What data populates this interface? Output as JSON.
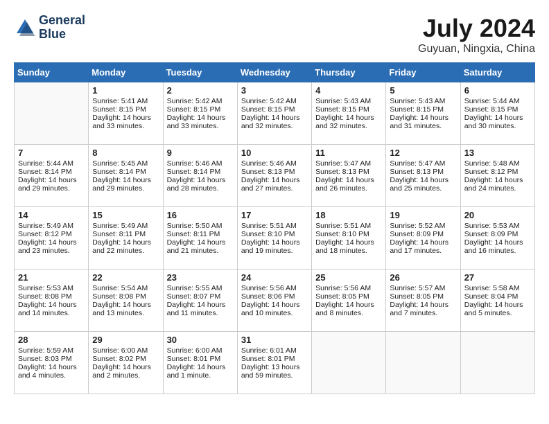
{
  "header": {
    "logo_line1": "General",
    "logo_line2": "Blue",
    "month": "July 2024",
    "location": "Guyuan, Ningxia, China"
  },
  "weekdays": [
    "Sunday",
    "Monday",
    "Tuesday",
    "Wednesday",
    "Thursday",
    "Friday",
    "Saturday"
  ],
  "weeks": [
    [
      {
        "day": "",
        "sunrise": "",
        "sunset": "",
        "daylight": ""
      },
      {
        "day": "1",
        "sunrise": "Sunrise: 5:41 AM",
        "sunset": "Sunset: 8:15 PM",
        "daylight": "Daylight: 14 hours and 33 minutes."
      },
      {
        "day": "2",
        "sunrise": "Sunrise: 5:42 AM",
        "sunset": "Sunset: 8:15 PM",
        "daylight": "Daylight: 14 hours and 33 minutes."
      },
      {
        "day": "3",
        "sunrise": "Sunrise: 5:42 AM",
        "sunset": "Sunset: 8:15 PM",
        "daylight": "Daylight: 14 hours and 32 minutes."
      },
      {
        "day": "4",
        "sunrise": "Sunrise: 5:43 AM",
        "sunset": "Sunset: 8:15 PM",
        "daylight": "Daylight: 14 hours and 32 minutes."
      },
      {
        "day": "5",
        "sunrise": "Sunrise: 5:43 AM",
        "sunset": "Sunset: 8:15 PM",
        "daylight": "Daylight: 14 hours and 31 minutes."
      },
      {
        "day": "6",
        "sunrise": "Sunrise: 5:44 AM",
        "sunset": "Sunset: 8:15 PM",
        "daylight": "Daylight: 14 hours and 30 minutes."
      }
    ],
    [
      {
        "day": "7",
        "sunrise": "Sunrise: 5:44 AM",
        "sunset": "Sunset: 8:14 PM",
        "daylight": "Daylight: 14 hours and 29 minutes."
      },
      {
        "day": "8",
        "sunrise": "Sunrise: 5:45 AM",
        "sunset": "Sunset: 8:14 PM",
        "daylight": "Daylight: 14 hours and 29 minutes."
      },
      {
        "day": "9",
        "sunrise": "Sunrise: 5:46 AM",
        "sunset": "Sunset: 8:14 PM",
        "daylight": "Daylight: 14 hours and 28 minutes."
      },
      {
        "day": "10",
        "sunrise": "Sunrise: 5:46 AM",
        "sunset": "Sunset: 8:13 PM",
        "daylight": "Daylight: 14 hours and 27 minutes."
      },
      {
        "day": "11",
        "sunrise": "Sunrise: 5:47 AM",
        "sunset": "Sunset: 8:13 PM",
        "daylight": "Daylight: 14 hours and 26 minutes."
      },
      {
        "day": "12",
        "sunrise": "Sunrise: 5:47 AM",
        "sunset": "Sunset: 8:13 PM",
        "daylight": "Daylight: 14 hours and 25 minutes."
      },
      {
        "day": "13",
        "sunrise": "Sunrise: 5:48 AM",
        "sunset": "Sunset: 8:12 PM",
        "daylight": "Daylight: 14 hours and 24 minutes."
      }
    ],
    [
      {
        "day": "14",
        "sunrise": "Sunrise: 5:49 AM",
        "sunset": "Sunset: 8:12 PM",
        "daylight": "Daylight: 14 hours and 23 minutes."
      },
      {
        "day": "15",
        "sunrise": "Sunrise: 5:49 AM",
        "sunset": "Sunset: 8:11 PM",
        "daylight": "Daylight: 14 hours and 22 minutes."
      },
      {
        "day": "16",
        "sunrise": "Sunrise: 5:50 AM",
        "sunset": "Sunset: 8:11 PM",
        "daylight": "Daylight: 14 hours and 21 minutes."
      },
      {
        "day": "17",
        "sunrise": "Sunrise: 5:51 AM",
        "sunset": "Sunset: 8:10 PM",
        "daylight": "Daylight: 14 hours and 19 minutes."
      },
      {
        "day": "18",
        "sunrise": "Sunrise: 5:51 AM",
        "sunset": "Sunset: 8:10 PM",
        "daylight": "Daylight: 14 hours and 18 minutes."
      },
      {
        "day": "19",
        "sunrise": "Sunrise: 5:52 AM",
        "sunset": "Sunset: 8:09 PM",
        "daylight": "Daylight: 14 hours and 17 minutes."
      },
      {
        "day": "20",
        "sunrise": "Sunrise: 5:53 AM",
        "sunset": "Sunset: 8:09 PM",
        "daylight": "Daylight: 14 hours and 16 minutes."
      }
    ],
    [
      {
        "day": "21",
        "sunrise": "Sunrise: 5:53 AM",
        "sunset": "Sunset: 8:08 PM",
        "daylight": "Daylight: 14 hours and 14 minutes."
      },
      {
        "day": "22",
        "sunrise": "Sunrise: 5:54 AM",
        "sunset": "Sunset: 8:08 PM",
        "daylight": "Daylight: 14 hours and 13 minutes."
      },
      {
        "day": "23",
        "sunrise": "Sunrise: 5:55 AM",
        "sunset": "Sunset: 8:07 PM",
        "daylight": "Daylight: 14 hours and 11 minutes."
      },
      {
        "day": "24",
        "sunrise": "Sunrise: 5:56 AM",
        "sunset": "Sunset: 8:06 PM",
        "daylight": "Daylight: 14 hours and 10 minutes."
      },
      {
        "day": "25",
        "sunrise": "Sunrise: 5:56 AM",
        "sunset": "Sunset: 8:05 PM",
        "daylight": "Daylight: 14 hours and 8 minutes."
      },
      {
        "day": "26",
        "sunrise": "Sunrise: 5:57 AM",
        "sunset": "Sunset: 8:05 PM",
        "daylight": "Daylight: 14 hours and 7 minutes."
      },
      {
        "day": "27",
        "sunrise": "Sunrise: 5:58 AM",
        "sunset": "Sunset: 8:04 PM",
        "daylight": "Daylight: 14 hours and 5 minutes."
      }
    ],
    [
      {
        "day": "28",
        "sunrise": "Sunrise: 5:59 AM",
        "sunset": "Sunset: 8:03 PM",
        "daylight": "Daylight: 14 hours and 4 minutes."
      },
      {
        "day": "29",
        "sunrise": "Sunrise: 6:00 AM",
        "sunset": "Sunset: 8:02 PM",
        "daylight": "Daylight: 14 hours and 2 minutes."
      },
      {
        "day": "30",
        "sunrise": "Sunrise: 6:00 AM",
        "sunset": "Sunset: 8:01 PM",
        "daylight": "Daylight: 14 hours and 1 minute."
      },
      {
        "day": "31",
        "sunrise": "Sunrise: 6:01 AM",
        "sunset": "Sunset: 8:01 PM",
        "daylight": "Daylight: 13 hours and 59 minutes."
      },
      {
        "day": "",
        "sunrise": "",
        "sunset": "",
        "daylight": ""
      },
      {
        "day": "",
        "sunrise": "",
        "sunset": "",
        "daylight": ""
      },
      {
        "day": "",
        "sunrise": "",
        "sunset": "",
        "daylight": ""
      }
    ]
  ]
}
